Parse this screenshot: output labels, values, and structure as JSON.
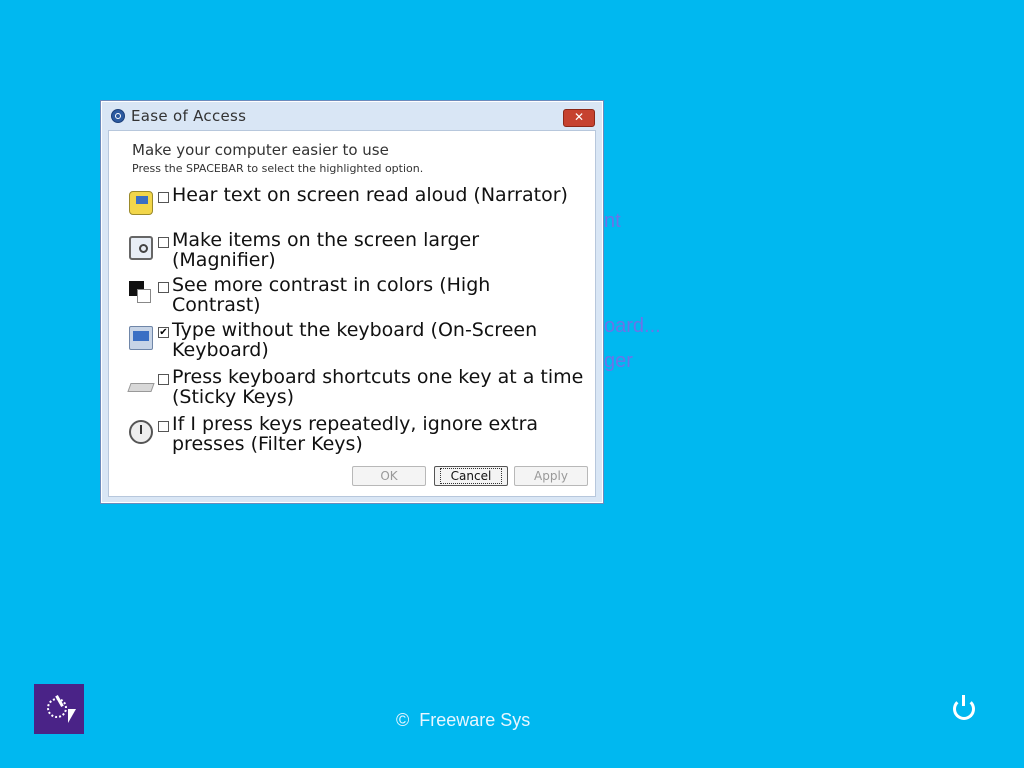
{
  "background_text": [
    "nt",
    "oard...",
    "ger"
  ],
  "dialog": {
    "title": "Ease of Access",
    "close_label": "✕",
    "heading": "Make your computer easier to use",
    "subheading": "Press the SPACEBAR to select the highlighted option.",
    "options": [
      {
        "label": "Hear text on screen read aloud (Narrator)",
        "checked": false,
        "icon": "narrator-icon"
      },
      {
        "label": "Make items on the screen larger (Magnifier)",
        "checked": false,
        "icon": "magnifier-icon"
      },
      {
        "label": "See more contrast in colors (High Contrast)",
        "checked": false,
        "icon": "high-contrast-icon"
      },
      {
        "label": "Type without the keyboard (On-Screen Keyboard)",
        "checked": true,
        "icon": "on-screen-keyboard-icon"
      },
      {
        "label": "Press keyboard shortcuts one key at a time (Sticky Keys)",
        "checked": false,
        "icon": "sticky-keys-icon"
      },
      {
        "label": "If I press keys repeatedly, ignore extra presses (Filter Keys)",
        "checked": false,
        "icon": "filter-keys-icon"
      }
    ],
    "buttons": {
      "ok": "OK",
      "cancel": "Cancel",
      "apply": "Apply"
    }
  },
  "footer": {
    "brand": "Freeware Sys",
    "copyright_symbol": "©"
  },
  "colors": {
    "background": "#00b8f0",
    "ease_tile": "#4a2387"
  }
}
